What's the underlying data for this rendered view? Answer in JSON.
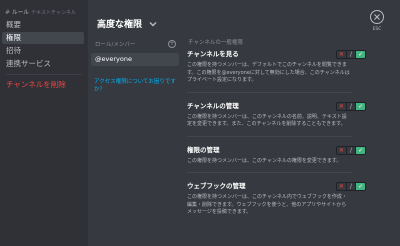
{
  "sidebar": {
    "breadcrumb": {
      "hash": "#",
      "channel": "ルール",
      "category": "テキストチャンネル"
    },
    "items": [
      {
        "label": "概要"
      },
      {
        "label": "権限"
      },
      {
        "label": "招待"
      },
      {
        "label": "連携サービス"
      }
    ],
    "delete_label": "チャンネルを削除"
  },
  "header": {
    "title": "高度な権限"
  },
  "roles": {
    "header": "ロール/メンバー",
    "plus_glyph": "+",
    "selected": "@everyone",
    "help_link": "アクセス権限についてお困りですか？"
  },
  "permissions": {
    "section_label": "チャンネルの一般権限",
    "items": [
      {
        "title": "チャンネルを見る",
        "desc": "この権限を持つメンバーは、デフォルトでこのチャンネルを閲覧できます。この権限を@everyoneに対して無効にした場合、このチャンネルはプライベート設定になります。"
      },
      {
        "title": "チャンネルの管理",
        "desc": "この権限を持つメンバーは、このチャンネルの名前、説明、テキスト設定を変更できます。また、このチャンネルを削除することもできます。"
      },
      {
        "title": "権限の管理",
        "desc": "この権限を持つメンバーは、このチャンネルの権限を変更できます。"
      },
      {
        "title": "ウェブフックの管理",
        "desc": "この権限を持つメンバーは、このチャンネル内でウェブフックを作成・編集・削除できます。ウェブフックを使うと、他のアプリやサイトからメッセージを投稿できます。"
      }
    ],
    "toggle": {
      "deny": "✕",
      "neutral": "/",
      "allow": "✓"
    }
  },
  "close": {
    "esc_label": "ESC"
  },
  "colors": {
    "accent_green": "#43b581",
    "danger": "#f04747",
    "link": "#00b0f4"
  }
}
